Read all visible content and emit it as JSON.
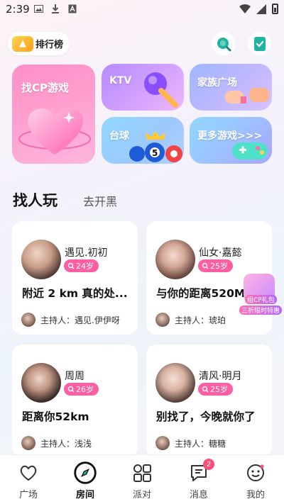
{
  "status_bar": {
    "time": "2:39"
  },
  "header": {
    "ranking_label": "排行榜"
  },
  "tiles": {
    "find_cp": "找CP游戏",
    "ktv": "KTV",
    "family": "家族广场",
    "billiards": "台球",
    "more_games": "更多游戏>>>"
  },
  "section": {
    "title": "找人玩",
    "subtitle": "去开黑"
  },
  "rooms": [
    {
      "name": "遇见.初初",
      "age": "24岁",
      "headline": "附近 2 km 真的处...",
      "host": "主持人：遇见.伊伊呀"
    },
    {
      "name": "仙女·嘉懿",
      "age": "25岁",
      "headline": "与你的距离520M",
      "host": "主持人：琥珀"
    },
    {
      "name": "周周",
      "age": "26岁",
      "headline": "距离你52km",
      "host": "主持人：浅浅"
    },
    {
      "name": "清风·明月",
      "age": "25岁",
      "headline": "别找了，今晚就你了",
      "host": "主持人：糖糖"
    }
  ],
  "promo": {
    "line1": "组CP礼包",
    "line2": "三折限时特惠"
  },
  "tabbar": {
    "items": [
      {
        "label": "广场"
      },
      {
        "label": "房间"
      },
      {
        "label": "派对"
      },
      {
        "label": "消息",
        "badge": "2"
      },
      {
        "label": "我的"
      }
    ]
  },
  "colors": {
    "accent_pink": "#ff5fa2",
    "badge_red": "#ff4d79"
  }
}
